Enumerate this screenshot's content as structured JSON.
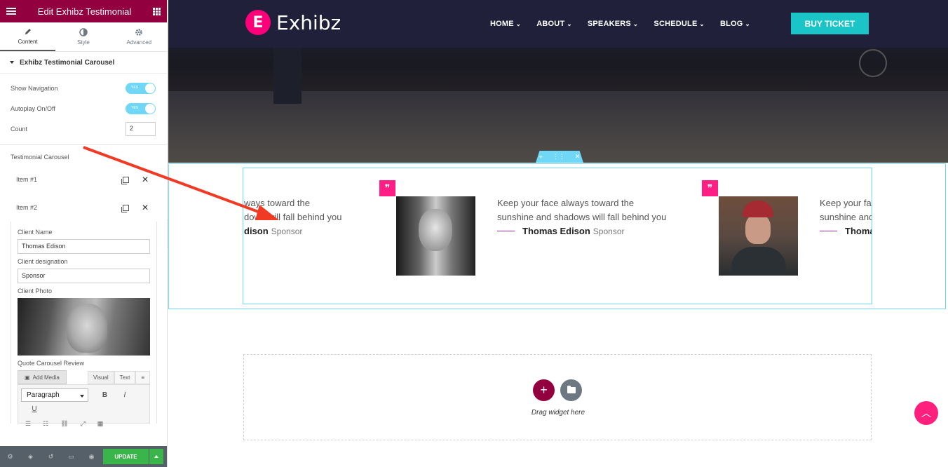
{
  "panel": {
    "title": "Edit Exhibz Testimonial",
    "tabs": [
      "Content",
      "Style",
      "Advanced"
    ],
    "section_title": "Exhibz Testimonial Carousel",
    "controls": {
      "show_navigation_label": "Show Navigation",
      "show_navigation_value": "YES",
      "autoplay_label": "Autoplay On/Off",
      "autoplay_value": "YES",
      "count_label": "Count",
      "count_value": "2"
    },
    "repeater_label": "Testimonial Carousel",
    "items": [
      "Item #1",
      "Item #2"
    ],
    "item2": {
      "client_name_label": "Client Name",
      "client_name_value": "Thomas Edison",
      "client_designation_label": "Client designation",
      "client_designation_value": "Sponsor",
      "client_photo_label": "Client Photo",
      "quote_label": "Quote Carousel Review",
      "add_media_label": "Add Media",
      "visual_tab": "Visual",
      "text_tab": "Text",
      "format_select": "Paragraph"
    },
    "footer": {
      "update_label": "UPDATE"
    }
  },
  "site": {
    "logo_letter": "E",
    "logo_text": "Exhibz",
    "menu": [
      "HOME",
      "ABOUT",
      "SPEAKERS",
      "SCHEDULE",
      "BLOG"
    ],
    "buy_ticket": "BUY TICKET"
  },
  "testimonials": [
    {
      "review_line1": "ways toward the",
      "review_line2": "dows will fall behind you",
      "name": "dison",
      "designation": "Sponsor"
    },
    {
      "review_line1": "Keep your face always toward the",
      "review_line2": "sunshine and shadows will fall behind you",
      "name": "Thomas Edison",
      "designation": "Sponsor"
    },
    {
      "review_line1": "Keep your fac",
      "review_line2": "sunshine and",
      "name": "Thoma",
      "designation": ""
    }
  ],
  "drop_zone": {
    "hint": "Drag widget here"
  },
  "colors": {
    "panel_header": "#93003f",
    "accent_pink": "#ff1f84",
    "buy_button": "#1bc4c6",
    "toggle_on": "#71d7f7",
    "update_green": "#39b54a",
    "annotation_arrow": "#f03a24"
  }
}
